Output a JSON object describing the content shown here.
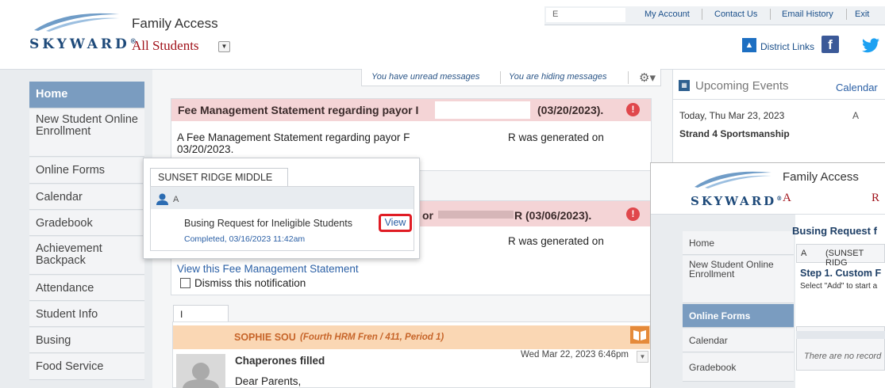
{
  "header": {
    "logo_text": "SKYWARD",
    "app_title": "Family Access",
    "student_selector": "All Students",
    "user_field": "E",
    "top_links": [
      "My Account",
      "Contact Us",
      "Email History",
      "Exit"
    ],
    "district_links": "District Links"
  },
  "sidebar": {
    "items": [
      {
        "label": "Home"
      },
      {
        "label": "New Student Online Enrollment"
      },
      {
        "label": "Online Forms"
      },
      {
        "label": "Calendar"
      },
      {
        "label": "Gradebook"
      },
      {
        "label": "Achievement Backpack"
      },
      {
        "label": "Attendance"
      },
      {
        "label": "Student Info"
      },
      {
        "label": "Busing"
      },
      {
        "label": "Food Service"
      }
    ]
  },
  "messages": {
    "unread": "You have unread messages",
    "hiding": "You are hiding messages"
  },
  "card1": {
    "title_start": "Fee Management Statement regarding payor I",
    "title_end": "(03/20/2023).",
    "body_start": "A Fee Management Statement regarding payor F",
    "body_end": "R was generated on",
    "body_date": "03/20/2023."
  },
  "card2": {
    "title_mid": "or",
    "title_end": "R (03/06/2023).",
    "body_end": "R was generated on",
    "view_link": "View this Fee Management Statement",
    "dismiss": "Dismiss this notification"
  },
  "popup": {
    "school_tab": "SUNSET RIDGE MIDDLE",
    "student": "A",
    "form_title": "Busing Request for Ineligible Students",
    "view_label": "View",
    "status": "Completed, 03/16/2023 11:42am"
  },
  "message3": {
    "tab": "I",
    "sender": "SOPHIE SOU",
    "course": "(Fourth HRM Fren / 411, Period 1)",
    "date": "Wed Mar 22, 2023 6:46pm",
    "subject": "Chaperones filled",
    "body": "Dear Parents,"
  },
  "events": {
    "title": "Upcoming Events",
    "calendar_link": "Calendar",
    "date1": "Today, Thu Mar 23, 2023",
    "initial1": "A",
    "event1": "Strand 4 Sportsmanship"
  },
  "overlay": {
    "title": "Family Access",
    "student_initial": "A",
    "red_char": "R",
    "form_heading": "Busing Request f",
    "student_row_initial": "A",
    "school": "(SUNSET RIDG",
    "step": "Step 1. Custom F",
    "instruction": "Select \"Add\" to start a",
    "no_records": "There are no record",
    "nav": [
      {
        "label": "Home"
      },
      {
        "label": "New Student Online Enrollment"
      },
      {
        "label": "Online Forms"
      },
      {
        "label": "Calendar"
      },
      {
        "label": "Gradebook"
      }
    ]
  },
  "colors": {
    "accent": "#7a9cc0",
    "alert": "#e0474c",
    "brand_red": "#a0121a",
    "link": "#2a5fa5"
  }
}
